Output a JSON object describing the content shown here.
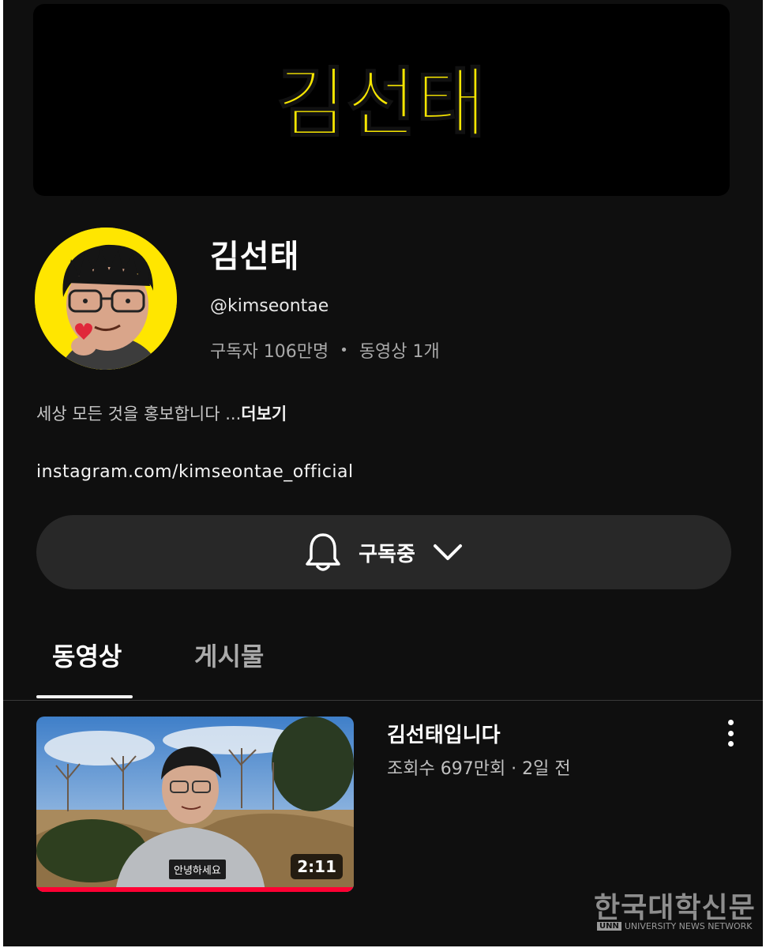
{
  "banner": {
    "logo_text": "김선태"
  },
  "channel": {
    "name": "김선태",
    "handle": "@kimseontae",
    "subscribers": "구독자 106만명",
    "separator": "•",
    "video_count": "동영상 1개",
    "description": "세상 모든 것을 홍보합니다 ...",
    "more_label": "더보기",
    "link": "instagram.com/kimseontae_official"
  },
  "subscribe_button": {
    "label": "구독중"
  },
  "tabs": [
    {
      "label": "동영상",
      "active": true
    },
    {
      "label": "게시물",
      "active": false
    }
  ],
  "videos": [
    {
      "title": "김선태입니다",
      "meta": "조회수 697만회 · 2일 전",
      "duration": "2:11",
      "caption": "안녕하세요",
      "watched_fraction": 1.0
    }
  ],
  "watermark": {
    "title": "한국대학신문",
    "unn": "UNN",
    "network": "UNIVERSITY NEWS NETWORK"
  },
  "colors": {
    "background": "#0f0f0f",
    "banner_logo_yellow": "#f7e600",
    "avatar_yellow": "#ffe600",
    "progress_red": "#ff0033",
    "button_bg": "#282828"
  },
  "icons": [
    "bell-icon",
    "chevron-down-icon",
    "more-vert-icon"
  ]
}
